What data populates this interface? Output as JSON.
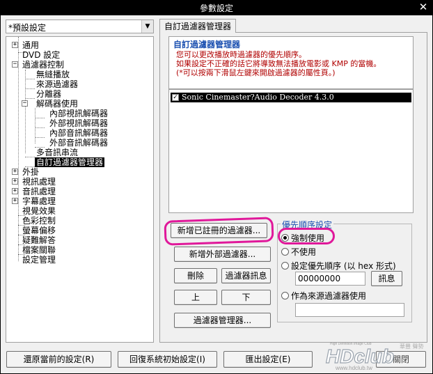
{
  "window": {
    "title": "參數設定",
    "close": "✕"
  },
  "preset": {
    "value": "*預設設定",
    "arrow": "▼"
  },
  "tree": {
    "items": [
      "通用",
      "DVD 設定",
      "過濾器控制",
      "無縫播放",
      "來源過濾器",
      "分離器",
      "解碼器使用",
      "內部視訊解碼器",
      "外部視訊解碼器",
      "內部音訊解碼器",
      "外部音訊解碼器",
      "多音訊串流",
      "自訂過濾器管理器",
      "外掛",
      "視訊處理",
      "音訊處理",
      "字幕處理",
      "視覺效果",
      "色彩控制",
      "螢幕偏移",
      "疑難解答",
      "檔案關聯",
      "設定管理"
    ],
    "expand_plus": "+",
    "expand_minus": "−"
  },
  "tab": {
    "label": "自訂過濾器管理器"
  },
  "description": {
    "heading": "自訂過濾器管理器",
    "lines": [
      "您可以更改播放時過濾器的優先順序。",
      "如果設定不正確的話它將導致無法播放電影或 KMP 的當機。",
      "(*可以按兩下滑鼠左鍵來開啟過濾器的屬性頁。)"
    ]
  },
  "filters": [
    {
      "checked": true,
      "check_mark": "✓",
      "name": "Sonic Cinemaster?Audio Decoder 4.3.0"
    }
  ],
  "buttons": {
    "add_registered": "新增已註冊的過濾器...",
    "add_external": "新增外部過濾器...",
    "delete": "刪除",
    "filter_info": "過濾器訊息",
    "up": "上",
    "down": "下",
    "filter_manager": "過濾器管理器..."
  },
  "priority": {
    "legend": "優先順序設定",
    "options": [
      {
        "label": "強制使用",
        "selected": true
      },
      {
        "label": "不使用",
        "selected": false
      },
      {
        "label": "設定優先順序 (以 hex 形式)",
        "selected": false
      },
      {
        "label": "作為來源過濾器使用",
        "selected": false
      }
    ],
    "hex_value": "00000000",
    "info_button": "訊息",
    "source_value": ""
  },
  "bottom": {
    "restore": "還原當前的設定(R)",
    "reset": "回復系統初始設定(I)",
    "export": "匯出設定(E)",
    "close": "關閉"
  },
  "watermark": {
    "main": "HDclub",
    "sub": "www.hdclub.tw",
    "tag": "High Definition Image Club",
    "cjk": "華豐 聲勢"
  },
  "colors": {
    "annotation": "#e0189a",
    "heading_blue": "#1a4fb0",
    "warning_red": "#b00000",
    "selection": "#000000"
  }
}
